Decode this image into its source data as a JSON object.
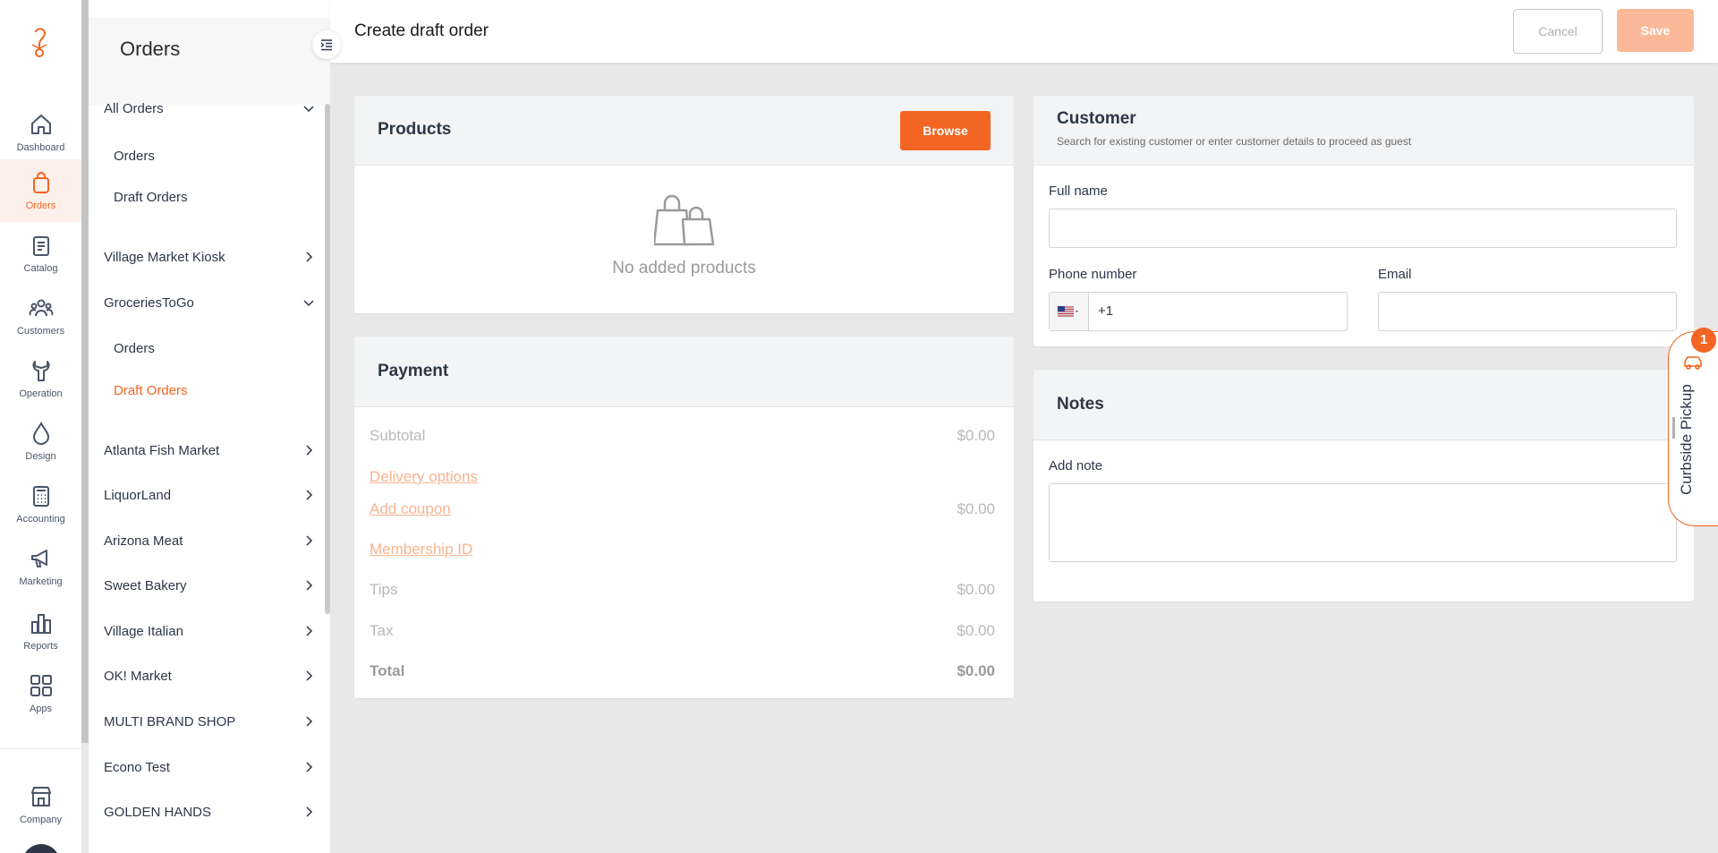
{
  "rail": {
    "items": [
      {
        "label": "Dashboard",
        "icon": "home-icon"
      },
      {
        "label": "Orders",
        "icon": "shopping-bag-icon"
      },
      {
        "label": "Catalog",
        "icon": "clipboard-icon"
      },
      {
        "label": "Customers",
        "icon": "users-icon"
      },
      {
        "label": "Operation",
        "icon": "wrench-icon"
      },
      {
        "label": "Design",
        "icon": "droplet-icon"
      },
      {
        "label": "Accounting",
        "icon": "calculator-icon"
      },
      {
        "label": "Marketing",
        "icon": "megaphone-icon"
      },
      {
        "label": "Reports",
        "icon": "bar-chart-icon"
      },
      {
        "label": "Apps",
        "icon": "apps-grid-icon"
      }
    ],
    "company_label": "Company",
    "accent_color": "#f26522"
  },
  "subnav": {
    "title": "Orders",
    "groups": [
      {
        "label": "All Orders",
        "expanded": true,
        "children": [
          "Orders",
          "Draft Orders"
        ]
      },
      {
        "label": "Village Market Kiosk"
      },
      {
        "label": "GroceriesToGo",
        "expanded": true,
        "children": [
          "Orders",
          "Draft Orders"
        ]
      },
      {
        "label": "Atlanta Fish Market"
      },
      {
        "label": "LiquorLand"
      },
      {
        "label": "Arizona Meat"
      },
      {
        "label": "Sweet Bakery"
      },
      {
        "label": "Village Italian"
      },
      {
        "label": "OK! Market"
      },
      {
        "label": "MULTI BRAND SHOP"
      },
      {
        "label": "Econo Test"
      },
      {
        "label": "GOLDEN HANDS"
      }
    ]
  },
  "header": {
    "title": "Create draft order",
    "cancel_label": "Cancel",
    "save_label": "Save"
  },
  "products": {
    "title": "Products",
    "browse_label": "Browse",
    "empty_text": "No added products"
  },
  "payment": {
    "title": "Payment",
    "subtotal_label": "Subtotal",
    "subtotal_value": "$0.00",
    "delivery_label": "Delivery options",
    "coupon_label": "Add coupon",
    "coupon_value": "$0.00",
    "membership_label": "Membership ID",
    "tips_label": "Tips",
    "tips_value": "$0.00",
    "tax_label": "Tax",
    "tax_value": "$0.00",
    "total_label": "Total",
    "total_value": "$0.00"
  },
  "customer": {
    "title": "Customer",
    "subtitle": "Search for existing customer or enter customer details to proceed as guest",
    "fullname_label": "Full name",
    "fullname_value": "",
    "phone_label": "Phone number",
    "phone_value": "+1",
    "email_label": "Email",
    "email_value": ""
  },
  "notes": {
    "title": "Notes",
    "add_note_label": "Add note",
    "note_value": ""
  },
  "curbside": {
    "label": "Curbside Pickup",
    "badge": "1"
  }
}
